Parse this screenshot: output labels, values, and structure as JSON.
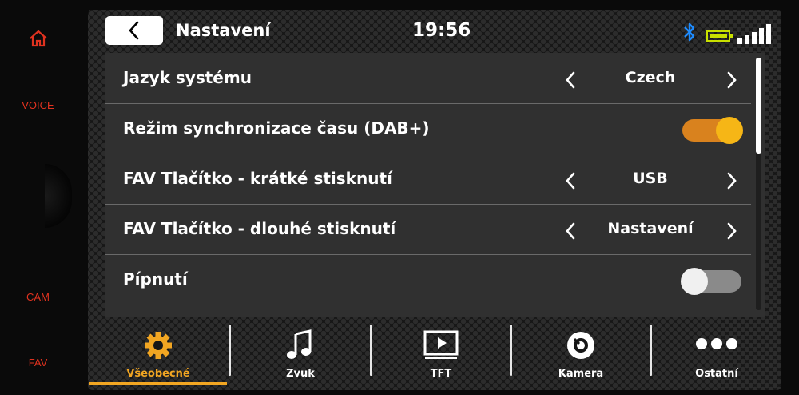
{
  "hardware": {
    "voice_label": "VOICE",
    "cam_label": "CAM",
    "fav_label": "FAV"
  },
  "header": {
    "title": "Nastavení",
    "time": "19:56"
  },
  "settings": {
    "rows": [
      {
        "label": "Jazyk systému",
        "value": "Czech"
      },
      {
        "label": "Režim synchronizace času (DAB+)",
        "toggle": "on"
      },
      {
        "label": "FAV Tlačítko - krátké stisknutí",
        "value": "USB"
      },
      {
        "label": "FAV Tlačítko - dlouhé stisknutí",
        "value": "Nastavení"
      },
      {
        "label": "Pípnutí",
        "toggle": "off"
      }
    ]
  },
  "tabs": [
    {
      "label": "Všeobecné",
      "icon": "gear-icon",
      "active": true
    },
    {
      "label": "Zvuk",
      "icon": "music-note-icon",
      "active": false
    },
    {
      "label": "TFT",
      "icon": "tft-play-icon",
      "active": false
    },
    {
      "label": "Kamera",
      "icon": "camera-icon",
      "active": false
    },
    {
      "label": "Ostatní",
      "icon": "more-dots-icon",
      "active": false
    }
  ],
  "colors": {
    "accent": "#f2a622",
    "hardware_buttons": "#e0321f",
    "bluetooth": "#1e8cff",
    "battery": "#c8e000"
  }
}
